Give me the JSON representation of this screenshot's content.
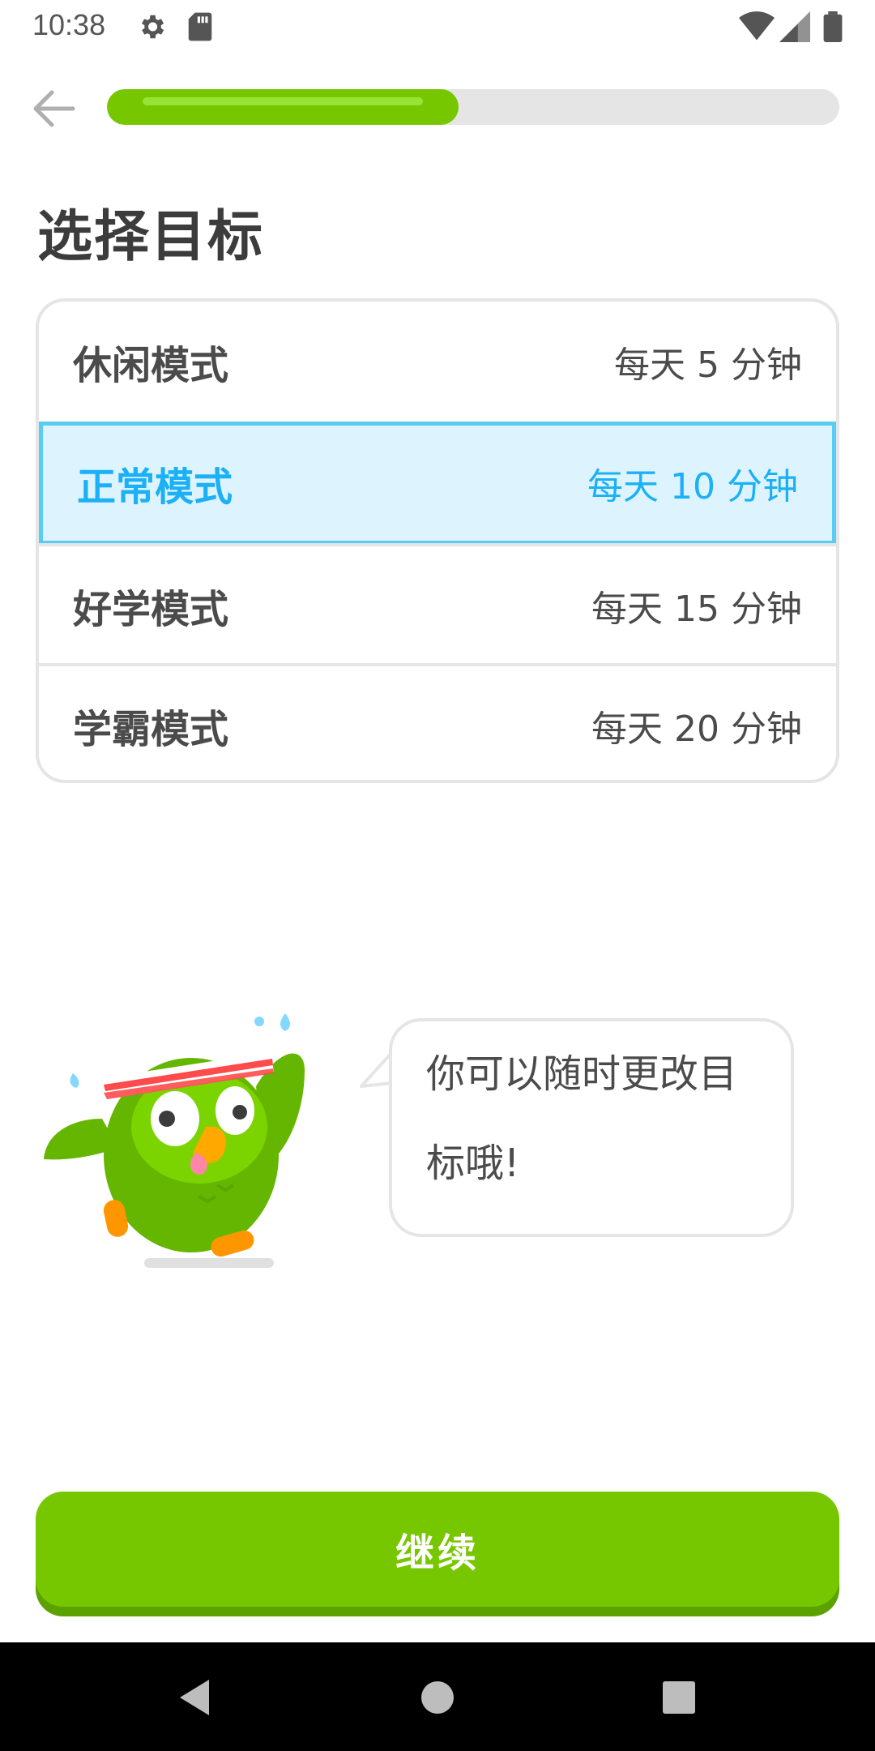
{
  "status_bar": {
    "time": "10:38",
    "icons": [
      "gear-icon",
      "sd-card-icon",
      "wifi-icon",
      "signal-icon",
      "battery-icon"
    ]
  },
  "header": {
    "back_icon": "arrow-left-icon",
    "progress": 0.48
  },
  "page_title": "选择目标",
  "goals": [
    {
      "name": "休闲模式",
      "time": "每天 5 分钟",
      "selected": false
    },
    {
      "name": "正常模式",
      "time": "每天 10 分钟",
      "selected": true
    },
    {
      "name": "好学模式",
      "time": "每天 15 分钟",
      "selected": false
    },
    {
      "name": "学霸模式",
      "time": "每天 20 分钟",
      "selected": false
    }
  ],
  "mascot": {
    "icon": "owl-mascot-icon"
  },
  "bubble": {
    "text": "你可以随时更改目标哦!"
  },
  "continue_label": "继续",
  "nav_bar": {
    "icons": [
      "nav-back-icon",
      "nav-home-icon",
      "nav-recents-icon"
    ]
  },
  "colors": {
    "green": "#77c700",
    "green_shadow": "#5ba100",
    "selected_bg": "#ddf4ff",
    "selected_border": "#58ccf5",
    "selected_text": "#1cb0f6",
    "border_gray": "#e5e5e5"
  }
}
